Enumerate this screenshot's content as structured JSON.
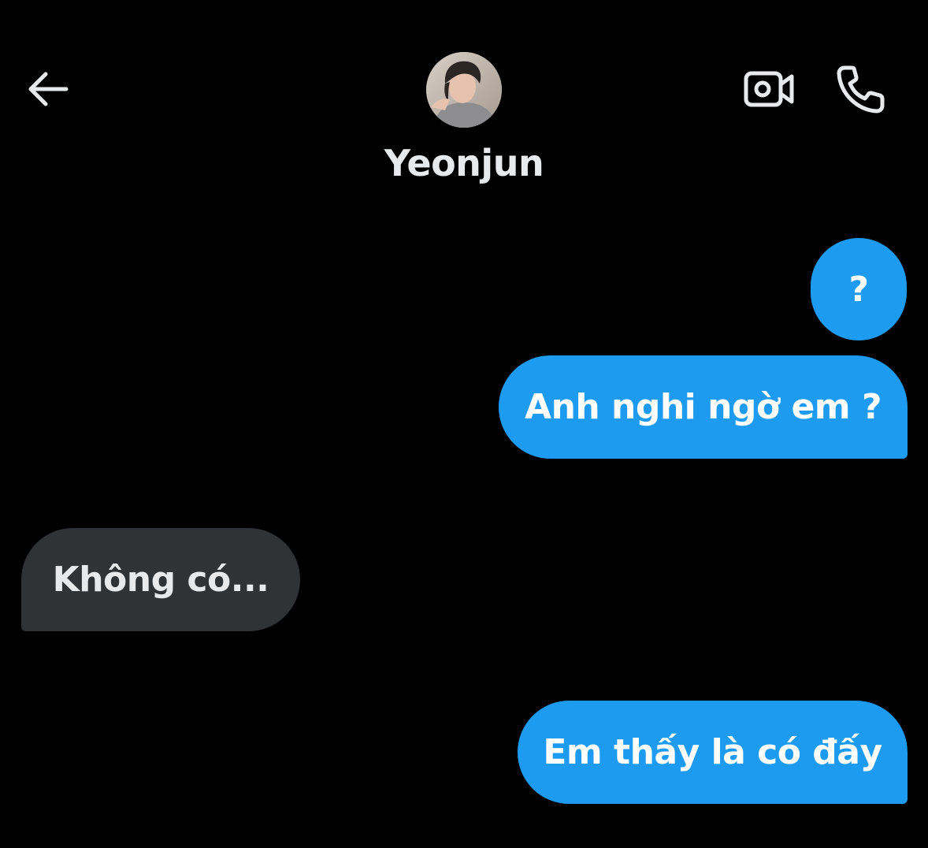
{
  "header": {
    "contact_name": "Yeonjun",
    "icons": {
      "back": "arrow-left-icon",
      "video": "video-camera-icon",
      "voice": "phone-icon"
    }
  },
  "messages": [
    {
      "text": "?",
      "direction": "sent"
    },
    {
      "text": "Anh nghi ngờ em ?",
      "direction": "sent"
    },
    {
      "text": "Không có...",
      "direction": "received"
    },
    {
      "text": "Em thấy là có đấy",
      "direction": "sent"
    }
  ],
  "colors": {
    "background": "#000000",
    "sent_bubble": "#1d9bf0",
    "received_bubble": "#2f3336",
    "text_primary": "#e7e9ea"
  }
}
